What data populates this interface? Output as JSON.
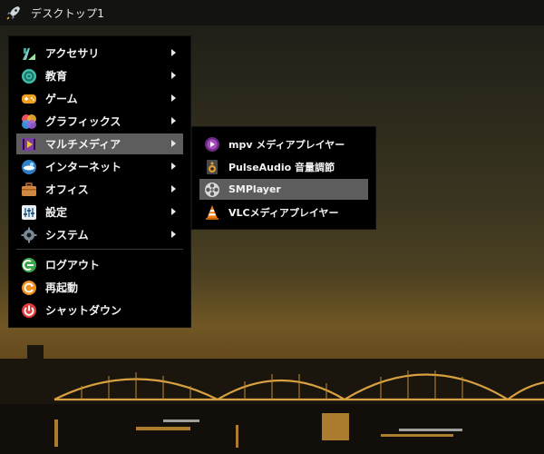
{
  "panel": {
    "workspace_title": "デスクトップ1"
  },
  "main_menu": {
    "items": [
      {
        "label": "アクセサリ",
        "icon": "accessories-icon",
        "has_submenu": true
      },
      {
        "label": "教育",
        "icon": "education-icon",
        "has_submenu": true
      },
      {
        "label": "ゲーム",
        "icon": "gamepad-icon",
        "has_submenu": true
      },
      {
        "label": "グラフィックス",
        "icon": "graphics-icon",
        "has_submenu": true
      },
      {
        "label": "マルチメディア",
        "icon": "multimedia-icon",
        "has_submenu": true,
        "active": true
      },
      {
        "label": "インターネット",
        "icon": "internet-icon",
        "has_submenu": true
      },
      {
        "label": "オフィス",
        "icon": "office-briefcase-icon",
        "has_submenu": true
      },
      {
        "label": "設定",
        "icon": "settings-icon",
        "has_submenu": true
      },
      {
        "label": "システム",
        "icon": "system-gear-icon",
        "has_submenu": true
      }
    ],
    "session_items": [
      {
        "label": "ログアウト",
        "icon": "logout-icon"
      },
      {
        "label": "再起動",
        "icon": "restart-icon"
      },
      {
        "label": "シャットダウン",
        "icon": "shutdown-icon"
      }
    ]
  },
  "sub_menu": {
    "items": [
      {
        "label": "mpv メディアプレイヤー",
        "icon": "mpv-icon"
      },
      {
        "label": "PulseAudio 音量調節",
        "icon": "speaker-icon"
      },
      {
        "label": "SMPlayer",
        "icon": "film-reel-icon",
        "active": true
      },
      {
        "label": "VLCメディアプレイヤー",
        "icon": "vlc-cone-icon"
      }
    ]
  },
  "colors": {
    "menu_bg": "#000000",
    "active_item_bg": "#5d5d5d",
    "text": "#f2f2f2"
  }
}
